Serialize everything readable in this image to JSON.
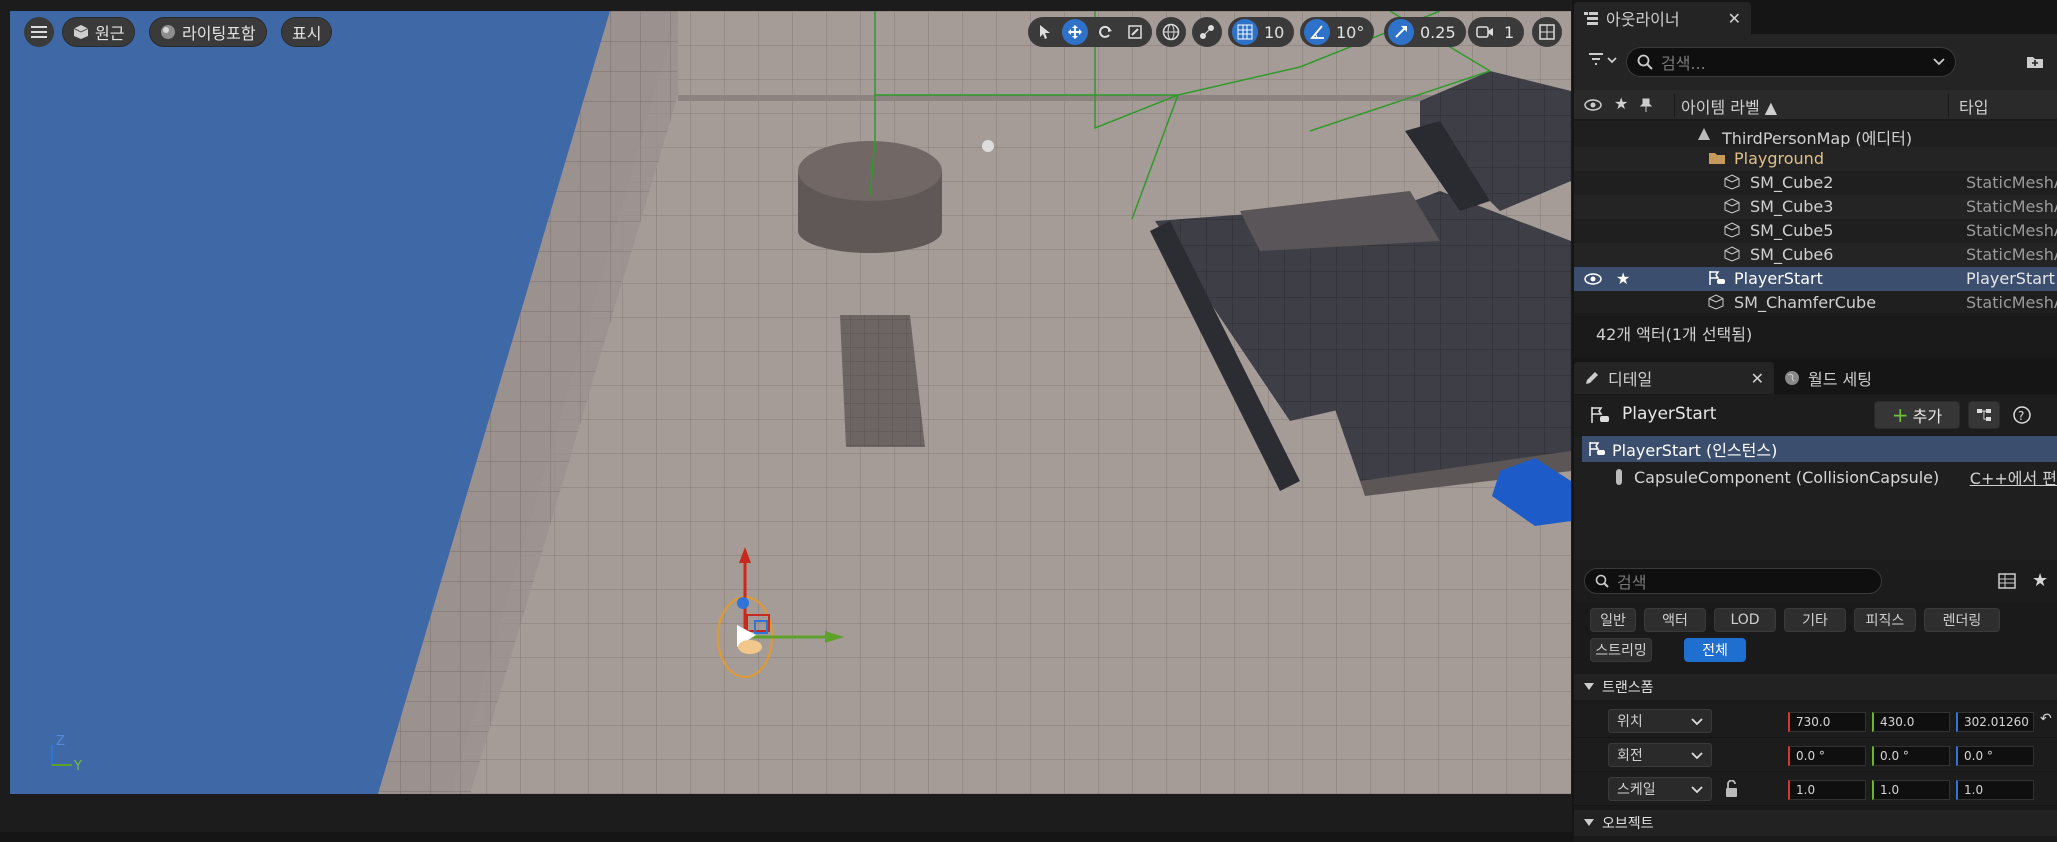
{
  "viewport": {
    "menu_icon": "hamburger-icon",
    "perspective_label": "원근",
    "lighting_label": "라이팅포함",
    "show_label": "표시",
    "grid_snap_value": "10",
    "rotation_snap_value": "10°",
    "scale_snap_value": "0.25",
    "camera_speed_value": "1",
    "axis_z": "Z",
    "axis_y": "Y"
  },
  "outliner": {
    "tab_label": "아웃라이너",
    "search_placeholder": "검색...",
    "col_item_label": "아이템 라벨 ▲",
    "col_type": "타입",
    "rows": [
      {
        "label": "ThirdPersonMap (에디터)",
        "type": ""
      },
      {
        "label": "Playground",
        "type": ""
      },
      {
        "label": "SM_Cube2",
        "type": "StaticMeshA"
      },
      {
        "label": "SM_Cube3",
        "type": "StaticMeshA"
      },
      {
        "label": "SM_Cube5",
        "type": "StaticMeshA"
      },
      {
        "label": "SM_Cube6",
        "type": "StaticMeshA"
      },
      {
        "label": "PlayerStart",
        "type": "PlayerStart"
      },
      {
        "label": "SM_ChamferCube",
        "type": "StaticMeshA"
      }
    ],
    "footer": "42개 액터(1개 선택됨)"
  },
  "details": {
    "tab_label": "디테일",
    "world_tab_label": "월드 세팅",
    "actor_name": "PlayerStart",
    "add_label": "추가",
    "components": [
      {
        "label": "PlayerStart (인스턴스)",
        "right": ""
      },
      {
        "label": "CapsuleComponent (CollisionCapsule)",
        "right": "C++에서 편"
      }
    ],
    "search_placeholder": "검색",
    "filters": [
      "일반",
      "액터",
      "LOD",
      "기타",
      "피직스",
      "렌더링",
      "스트리밍",
      "전체"
    ],
    "transform_header": "트랜스폼",
    "location_label": "위치",
    "rotation_label": "회전",
    "scale_label": "스케일",
    "location": [
      "730.0",
      "430.0",
      "302.01260"
    ],
    "rotation": [
      "0.0 °",
      "0.0 °",
      "0.0 °"
    ],
    "scale": [
      "1.0",
      "1.0",
      "1.0"
    ],
    "object_header": "오브젝트"
  },
  "colors": {
    "accent": "#2f72c9",
    "selection": "#3b4e6e",
    "sky": "#3f69a6",
    "floor": "#a49b97"
  }
}
